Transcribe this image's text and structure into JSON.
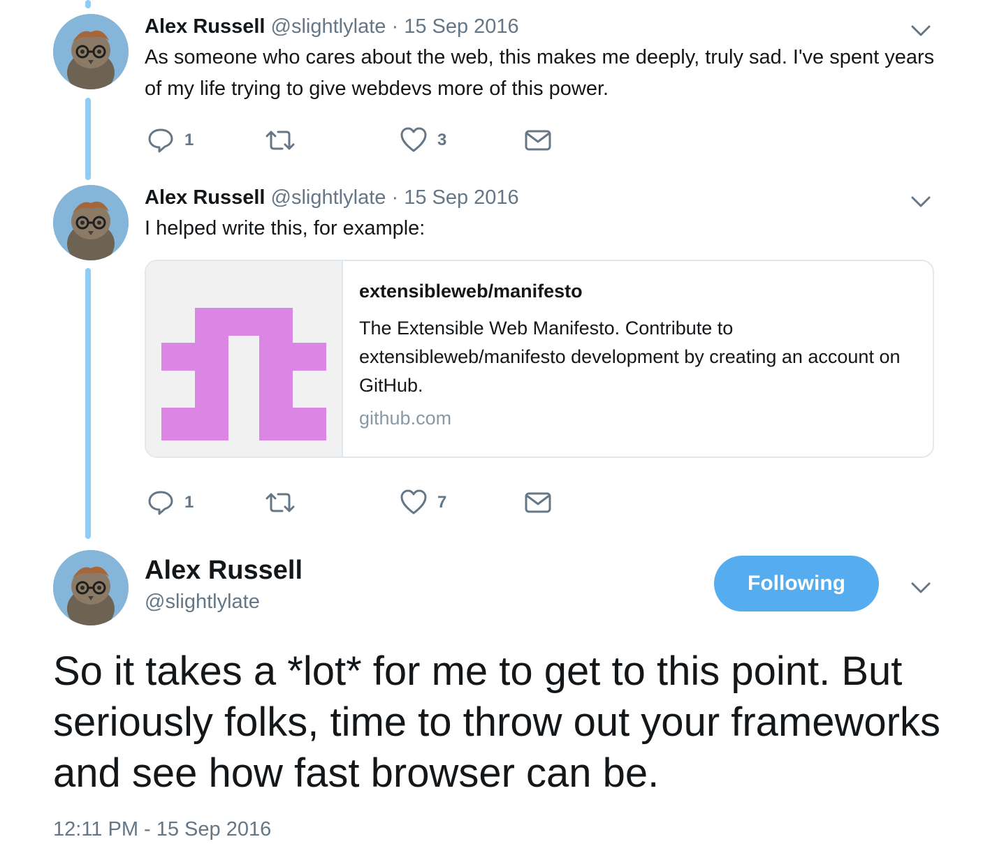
{
  "thread": [
    {
      "name": "Alex Russell",
      "handle": "@slightlylate",
      "dot": "·",
      "date": "15 Sep 2016",
      "text": "As someone who cares about the web, this makes me deeply, truly sad. I've spent years of my life trying to give webdevs more of this power.",
      "actions": {
        "reply_count": "1",
        "retweet_count": "",
        "like_count": "3"
      }
    },
    {
      "name": "Alex Russell",
      "handle": "@slightlylate",
      "dot": "·",
      "date": "15 Sep 2016",
      "text": "I helped write this, for example:",
      "card": {
        "title": "extensibleweb/manifesto",
        "description": "The Extensible Web Manifesto. Contribute to extensibleweb/manifesto development by creating an account on GitHub.",
        "domain": "github.com"
      },
      "actions": {
        "reply_count": "1",
        "retweet_count": "",
        "like_count": "7"
      }
    }
  ],
  "main_tweet": {
    "name": "Alex Russell",
    "handle": "@slightlylate",
    "follow_label": "Following",
    "text": "So it takes a *lot* for me to get to this point. But seriously folks, time to throw out your frameworks and see how fast browser can be.",
    "timestamp": "12:11 PM - 15 Sep 2016"
  },
  "icons": {
    "reply": "reply-icon",
    "retweet": "retweet-icon",
    "like": "heart-icon",
    "dm": "envelope-icon",
    "caret": "chevron-down-icon"
  },
  "colors": {
    "thread_line": "#8ecdf7",
    "follow_button": "#55acee",
    "card_logo": "#db86e5",
    "secondary_text": "#657786"
  }
}
